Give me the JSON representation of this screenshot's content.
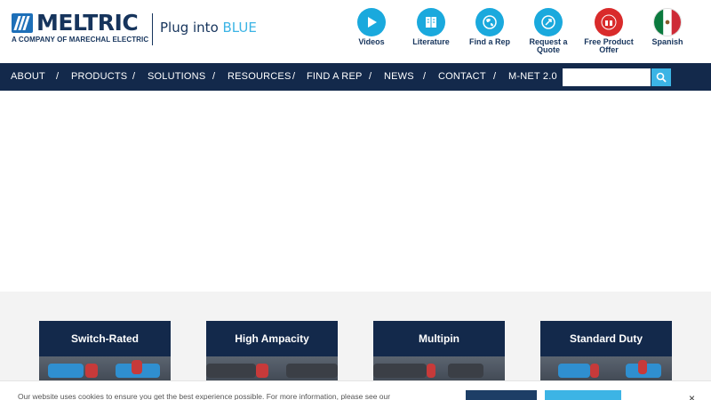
{
  "header": {
    "logo_text": "MELTRIC",
    "logo_sub": "A COMPANY OF MARECHAL ELECTRIC",
    "tagline_main": "Plug into ",
    "tagline_accent": "BLUE"
  },
  "quick_links": [
    {
      "label": "Videos",
      "icon": "play-icon",
      "color": "#1aa9dd"
    },
    {
      "label": "Literature",
      "icon": "book-icon",
      "color": "#1aa9dd"
    },
    {
      "label": "Find a Rep",
      "icon": "globe-icon",
      "color": "#1aa9dd"
    },
    {
      "label": "Request a Quote",
      "icon": "quote-icon",
      "color": "#1aa9dd"
    },
    {
      "label": "Free Product Offer",
      "icon": "free-badge-icon",
      "color": "#d92b2b"
    },
    {
      "label": "Spanish",
      "icon": "mexico-flag-icon",
      "color": "#ffffff"
    }
  ],
  "nav": {
    "items": [
      "ABOUT",
      "PRODUCTS",
      "SOLUTIONS",
      "RESOURCES",
      "FIND A REP",
      "NEWS",
      "CONTACT",
      "M-NET 2.0"
    ],
    "separator": "/",
    "search_placeholder": ""
  },
  "cards": [
    {
      "title": "Switch-Rated"
    },
    {
      "title": "High Ampacity"
    },
    {
      "title": "Multipin"
    },
    {
      "title": "Standard Duty"
    }
  ],
  "cookie": {
    "text": "Our website uses cookies to ensure you get the best experience possible. For more information, please see our",
    "settings_label": "",
    "accept_label": "",
    "close_symbol": "×"
  },
  "colors": {
    "navy": "#13294b",
    "accent_blue": "#3cb4e5"
  }
}
